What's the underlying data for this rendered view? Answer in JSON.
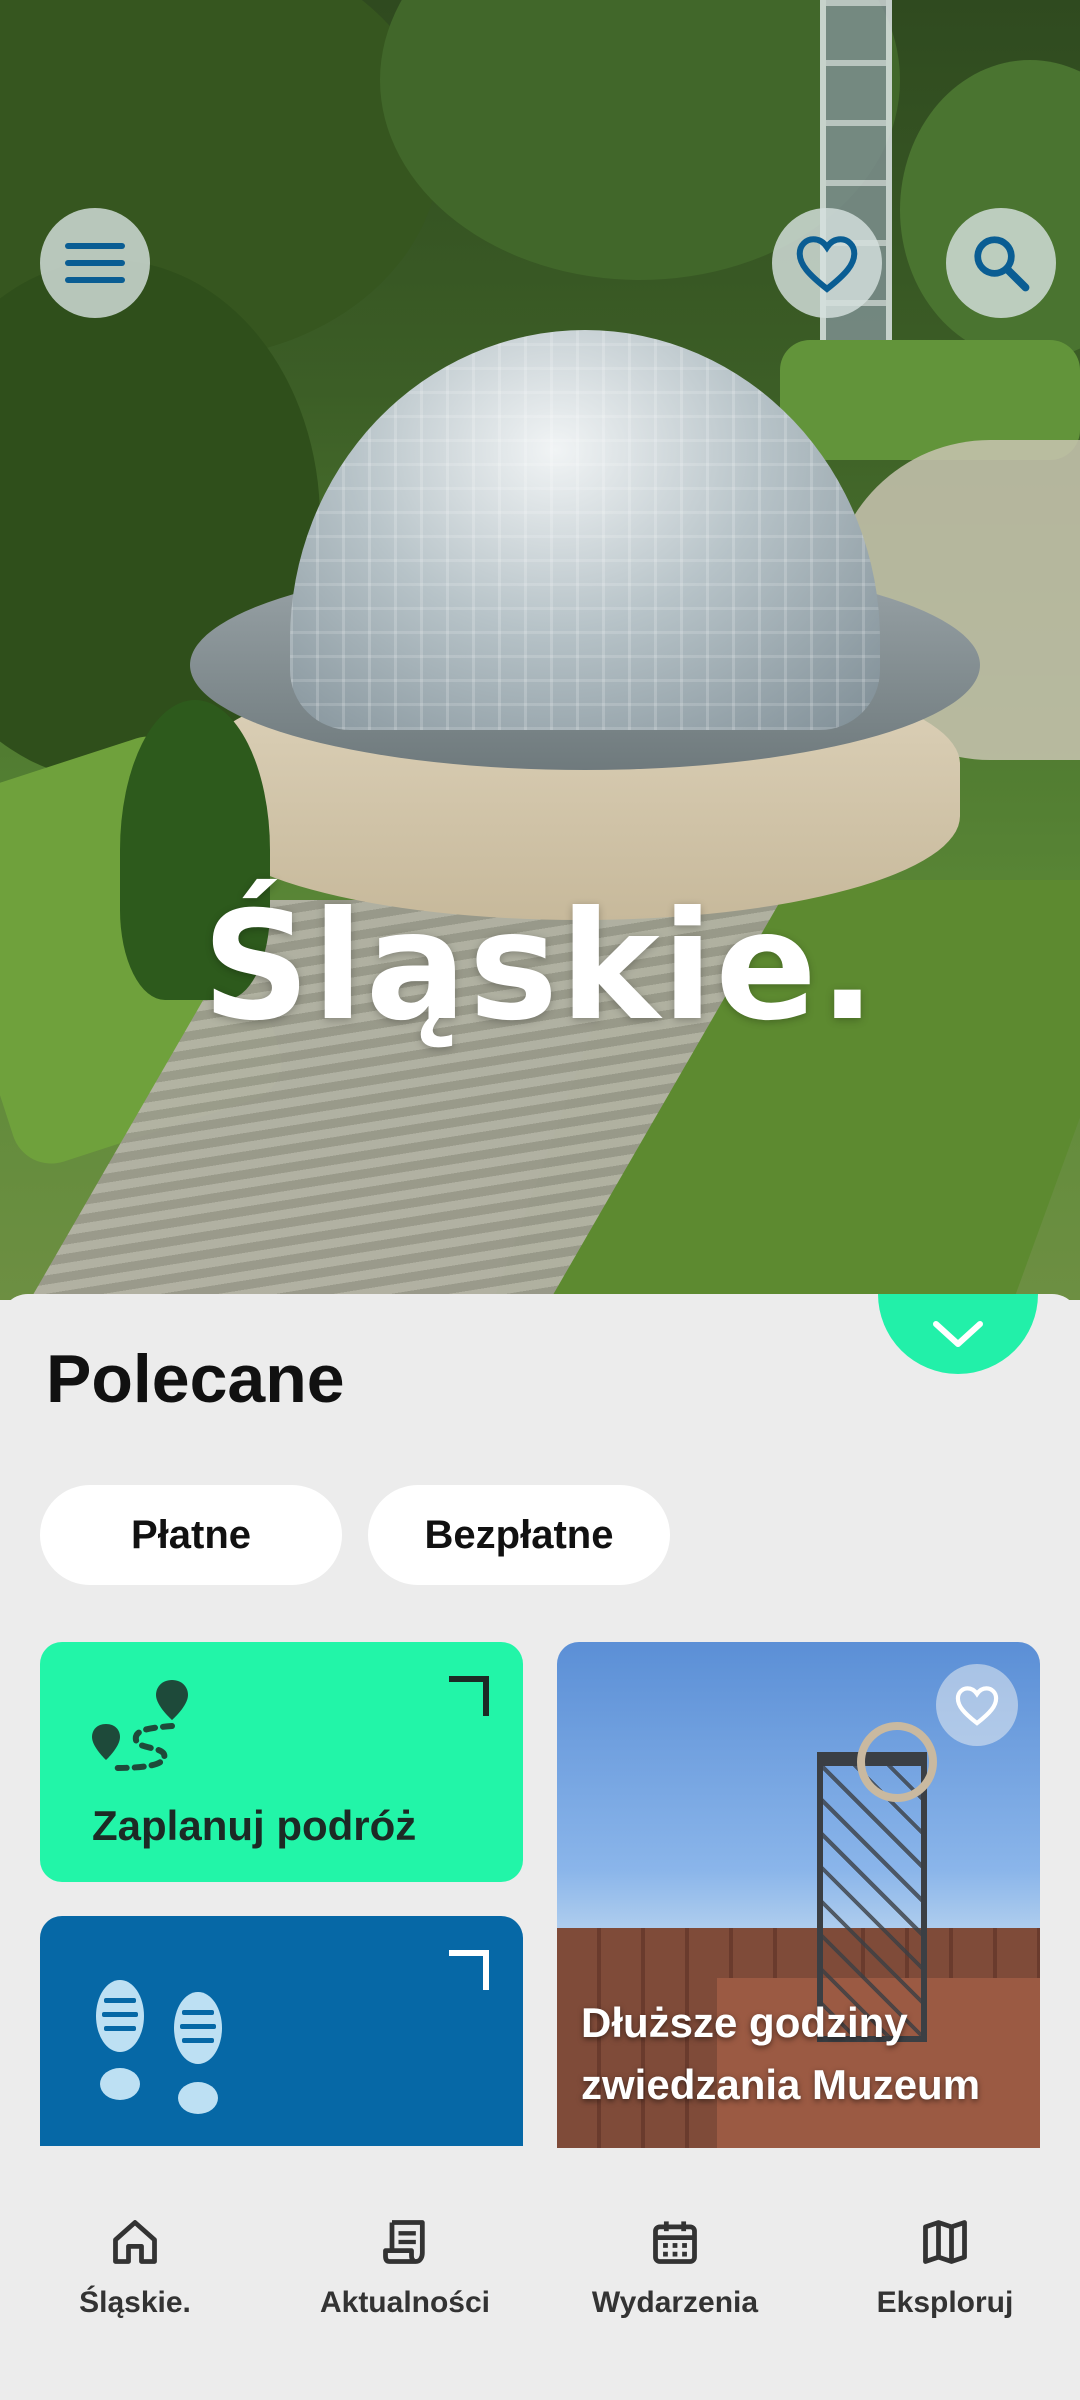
{
  "hero": {
    "title": "Śląskie.",
    "menu_icon": "hamburger-icon",
    "favorite_icon": "heart-icon",
    "search_icon": "search-icon"
  },
  "sheet": {
    "title": "Polecane",
    "collapse_icon": "chevron-down-icon",
    "filters": [
      {
        "label": "Płatne"
      },
      {
        "label": "Bezpłatne"
      }
    ],
    "cards": {
      "plan": {
        "label": "Zaplanuj podróż",
        "icon": "route-pins-icon"
      },
      "walks": {
        "label": "",
        "icon": "footprints-icon"
      },
      "museum": {
        "label": "Dłuższe godziny zwiedzania Muzeum",
        "icon": "heart-icon"
      }
    }
  },
  "bottom_nav": {
    "items": [
      {
        "label": "Śląskie.",
        "icon": "home-icon"
      },
      {
        "label": "Aktualności",
        "icon": "news-icon"
      },
      {
        "label": "Wydarzenia",
        "icon": "calendar-icon"
      },
      {
        "label": "Eksploruj",
        "icon": "map-icon"
      }
    ]
  },
  "colors": {
    "accent_green": "#22f0a9",
    "accent_blue": "#0668a6",
    "icon_blue": "#0a5d93",
    "background": "#ececec"
  }
}
